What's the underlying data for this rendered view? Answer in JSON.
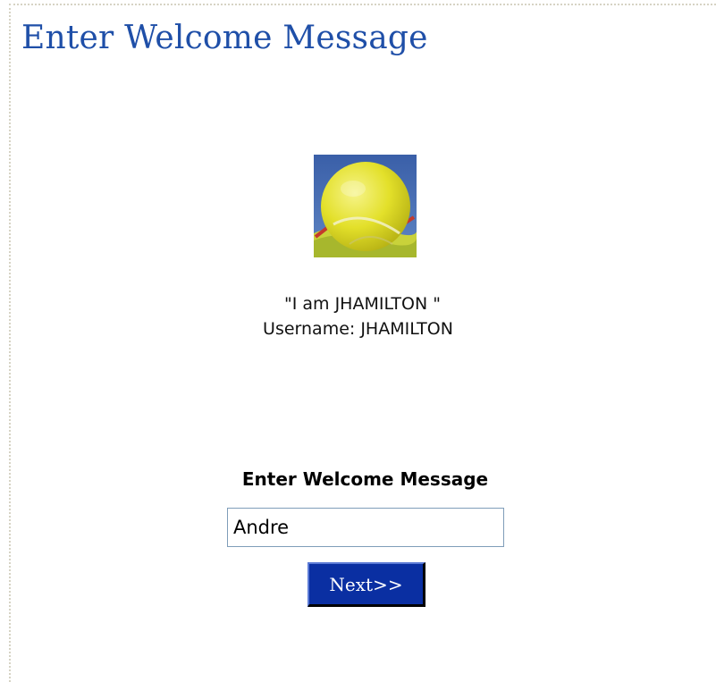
{
  "page": {
    "title": "Enter Welcome Message"
  },
  "profile": {
    "avatar_icon": "tennis-ball-image",
    "quote": "\"I am JHAMILTON \"",
    "username_line": "Username: JHAMILTON"
  },
  "form": {
    "label": "Enter Welcome Message",
    "message_value": "Andre",
    "next_label": "Next>>"
  },
  "colors": {
    "title": "#1f4fa8",
    "button_bg": "#0a2fa2",
    "input_border": "#7f9db9"
  }
}
